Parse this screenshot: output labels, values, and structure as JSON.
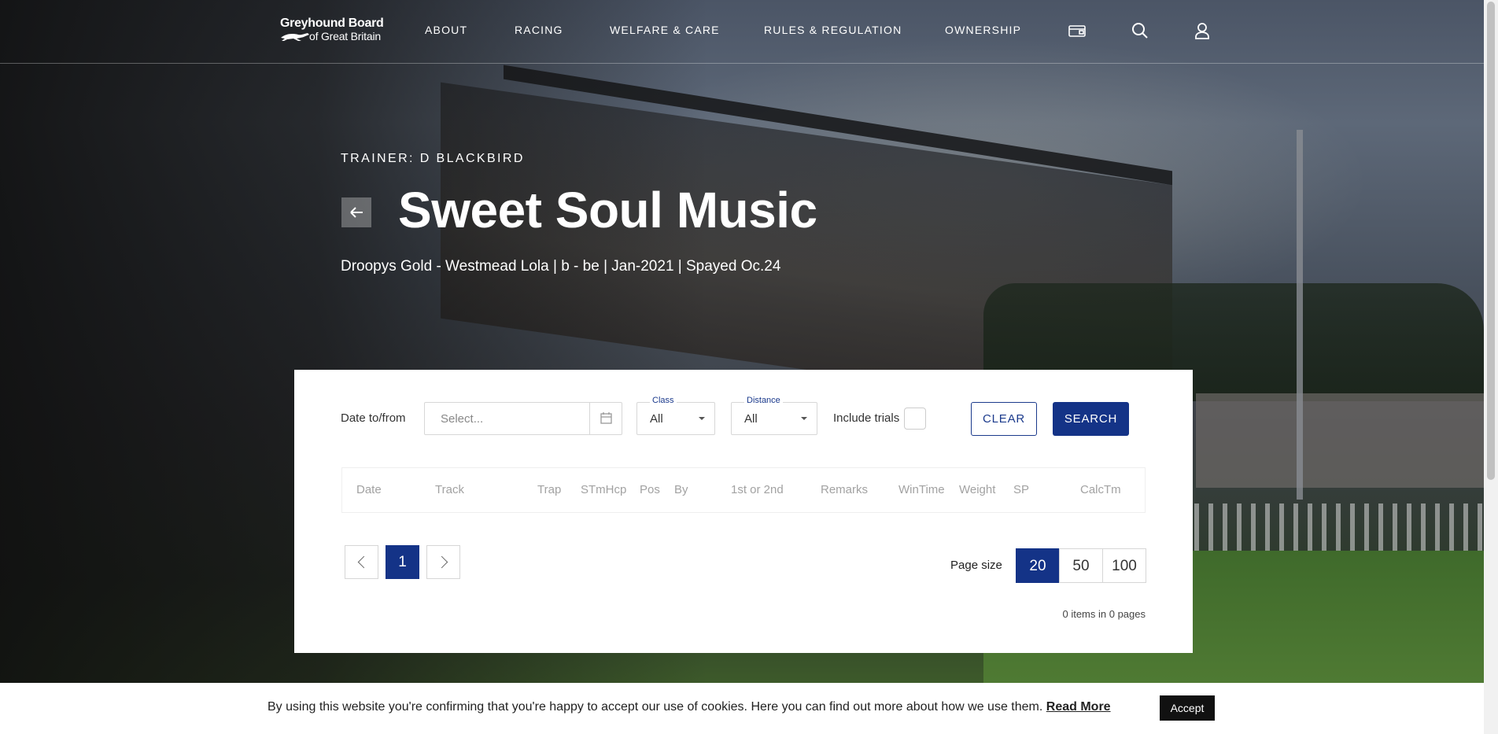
{
  "brand": {
    "line1": "Greyhound Board",
    "line2": "of Great Britain"
  },
  "nav": {
    "items": [
      "ABOUT",
      "RACING",
      "WELFARE & CARE",
      "RULES & REGULATION",
      "OWNERSHIP"
    ],
    "icons": [
      "wallet-icon",
      "search-icon",
      "user-icon"
    ]
  },
  "hero": {
    "trainer": "TRAINER: D BLACKBIRD",
    "title": "Sweet Soul Music",
    "subtitle": "Droopys Gold - Westmead Lola | b - be | Jan-2021 | Spayed Oc.24"
  },
  "filters": {
    "date_label": "Date to/from",
    "date_placeholder": "Select...",
    "class_caption": "Class",
    "class_value": "All",
    "distance_caption": "Distance",
    "distance_value": "All",
    "include_trials_label": "Include trials",
    "include_trials_checked": false,
    "clear_label": "CLEAR",
    "search_label": "SEARCH"
  },
  "table": {
    "columns": [
      "Date",
      "Track",
      "Trap",
      "STmHcp",
      "Pos",
      "By",
      "1st or 2nd",
      "Remarks",
      "WinTime",
      "Weight",
      "SP",
      "CalcTm"
    ],
    "rows": []
  },
  "pagination": {
    "current_page": "1",
    "page_size_label": "Page size",
    "page_sizes": [
      "20",
      "50",
      "100"
    ],
    "selected_page_size": "20",
    "items_info": "0 items in 0 pages"
  },
  "cookie": {
    "message": "By using this website you're confirming that you're happy to accept our use of cookies. Here you can find out more about how we use them.",
    "read_more": "Read More",
    "accept": "Accept"
  },
  "colors": {
    "primary": "#143387",
    "accent_text": "#1b3a8c"
  }
}
